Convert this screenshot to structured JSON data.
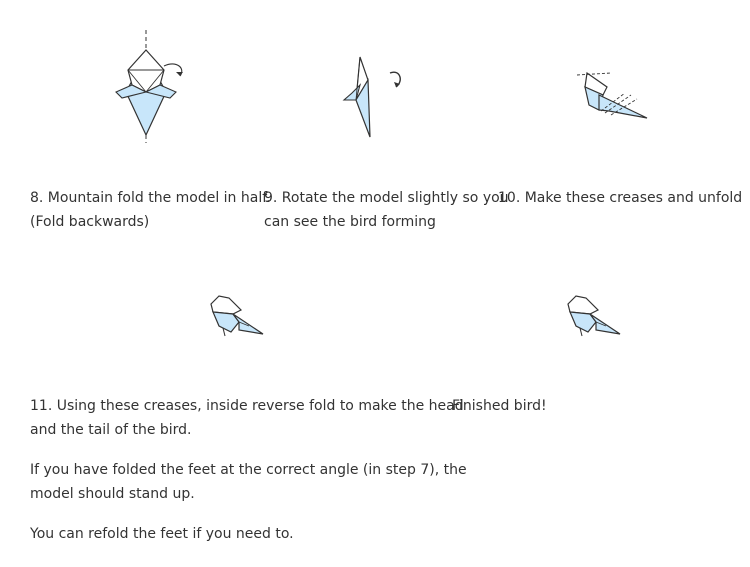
{
  "step8": {
    "line1": "8. Mountain fold the model in half.",
    "line2": "(Fold backwards)"
  },
  "step9": {
    "line1": "9. Rotate the model slightly so you",
    "line2": "can see the bird forming"
  },
  "step10": {
    "line1": "10. Make these creases and unfold"
  },
  "step11": {
    "line1": "11. Using these creases, inside reverse fold to make the head",
    "line2": "and the tail of the bird."
  },
  "finished": {
    "label": "Finished bird!"
  },
  "note1": {
    "line1": "If you have folded the feet at the correct angle (in step 7), the",
    "line2": "model should stand up."
  },
  "note2": {
    "line1": "You can refold the feet if you need to."
  },
  "colors": {
    "paper_blue": "#c8e6fa",
    "paper_white": "#ffffff",
    "line": "#333333",
    "text": "#333333"
  }
}
